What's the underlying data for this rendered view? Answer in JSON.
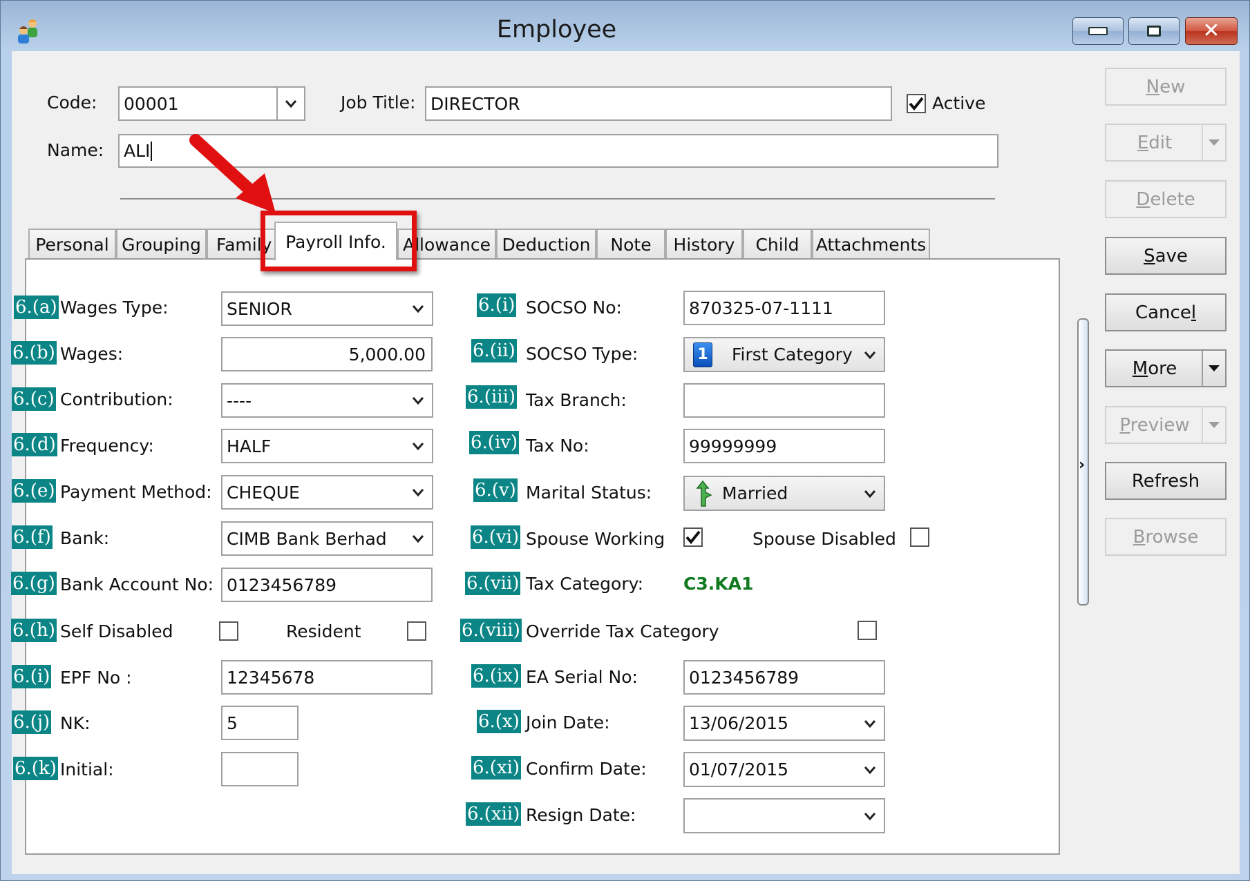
{
  "window": {
    "title": "Employee",
    "icon": "users-icon",
    "controls": {
      "minimize": "minimize-icon",
      "maximize": "maximize-icon",
      "close": "close-icon"
    }
  },
  "header": {
    "code_label": "Code:",
    "code_value": "00001",
    "job_title_label": "Job Title:",
    "job_title_value": "DIRECTOR",
    "active_label": "Active",
    "active_checked": true,
    "name_label": "Name:",
    "name_value": "ALI"
  },
  "tabs": [
    {
      "label": "Personal",
      "active": false
    },
    {
      "label": "Grouping",
      "active": false
    },
    {
      "label": "Family",
      "active": false
    },
    {
      "label": "Payroll Info.",
      "active": true
    },
    {
      "label": "Allowance",
      "active": false
    },
    {
      "label": "Deduction",
      "active": false
    },
    {
      "label": "Note",
      "active": false
    },
    {
      "label": "History",
      "active": false
    },
    {
      "label": "Child",
      "active": false
    },
    {
      "label": "Attachments",
      "active": false
    }
  ],
  "annotation": {
    "highlight_color": "#e01010",
    "badge_color": "#0b8585"
  },
  "left_fields": {
    "wages_type": {
      "badge": "6.(a)",
      "label": "Wages Type:",
      "value": "SENIOR"
    },
    "wages": {
      "badge": "6.(b)",
      "label": "Wages:",
      "value": "5,000.00"
    },
    "contribution": {
      "badge": "6.(c)",
      "label": "Contribution:",
      "value": "----"
    },
    "frequency": {
      "badge": "6.(d)",
      "label": "Frequency:",
      "value": "HALF"
    },
    "payment_method": {
      "badge": "6.(e)",
      "label": "Payment Method:",
      "value": "CHEQUE"
    },
    "bank": {
      "badge": "6.(f)",
      "label": "Bank:",
      "value": "CIMB Bank Berhad"
    },
    "bank_account": {
      "badge": "6.(g)",
      "label": "Bank Account No:",
      "value": "0123456789"
    },
    "self_disabled": {
      "badge": "6.(h)",
      "label": "Self Disabled",
      "checked": false,
      "resident_label": "Resident",
      "resident_checked": false
    },
    "epf_no": {
      "badge": "6.(i)",
      "label": "EPF No :",
      "value": "12345678"
    },
    "nk": {
      "badge": "6.(j)",
      "label": "NK:",
      "value": "5"
    },
    "initial": {
      "badge": "6.(k)",
      "label": "Initial:",
      "value": ""
    }
  },
  "right_fields": {
    "socso_no": {
      "badge": "6.(i)",
      "label": "SOCSO No:",
      "value": "870325-07-1111"
    },
    "socso_type": {
      "badge": "6.(ii)",
      "label": "SOCSO Type:",
      "value": "First Category",
      "icon_text": "1"
    },
    "tax_branch": {
      "badge": "6.(iii)",
      "label": "Tax Branch:",
      "value": ""
    },
    "tax_no": {
      "badge": "6.(iv)",
      "label": "Tax No:",
      "value": "99999999"
    },
    "marital_status": {
      "badge": "6.(v)",
      "label": "Marital Status:",
      "value": "Married"
    },
    "spouse_working": {
      "badge": "6.(vi)",
      "label": "Spouse Working",
      "checked": true,
      "spouse_disabled_label": "Spouse Disabled",
      "spouse_disabled_checked": false
    },
    "tax_category": {
      "badge": "6.(vii)",
      "label": "Tax Category:",
      "value": "C3.KA1",
      "value_color": "#0f7a1e"
    },
    "override_tax": {
      "badge": "6.(viii)",
      "label": "Override Tax Category",
      "checked": false
    },
    "ea_serial": {
      "badge": "6.(ix)",
      "label": "EA Serial No:",
      "value": "0123456789"
    },
    "join_date": {
      "badge": "6.(x)",
      "label": "Join Date:",
      "value": "13/06/2015"
    },
    "confirm_date": {
      "badge": "6.(xi)",
      "label": "Confirm Date:",
      "value": "01/07/2015"
    },
    "resign_date": {
      "badge": "6.(xii)",
      "label": "Resign Date:",
      "value": ""
    }
  },
  "actions": {
    "new": {
      "pre": "",
      "ul": "N",
      "post": "ew",
      "enabled": false
    },
    "edit": {
      "pre": "",
      "ul": "E",
      "post": "dit",
      "enabled": false
    },
    "delete": {
      "pre": "",
      "ul": "D",
      "post": "elete",
      "enabled": false
    },
    "save": {
      "pre": "",
      "ul": "S",
      "post": "ave",
      "enabled": true
    },
    "cancel": {
      "pre": "Cance",
      "ul": "l",
      "post": "",
      "enabled": true
    },
    "more": {
      "pre": "",
      "ul": "M",
      "post": "ore",
      "enabled": true
    },
    "preview": {
      "pre": "",
      "ul": "P",
      "post": "review",
      "enabled": false
    },
    "refresh": {
      "pre": "Refresh",
      "ul": "",
      "post": "",
      "enabled": true
    },
    "browse": {
      "pre": "",
      "ul": "B",
      "post": "rowse",
      "enabled": false
    }
  }
}
